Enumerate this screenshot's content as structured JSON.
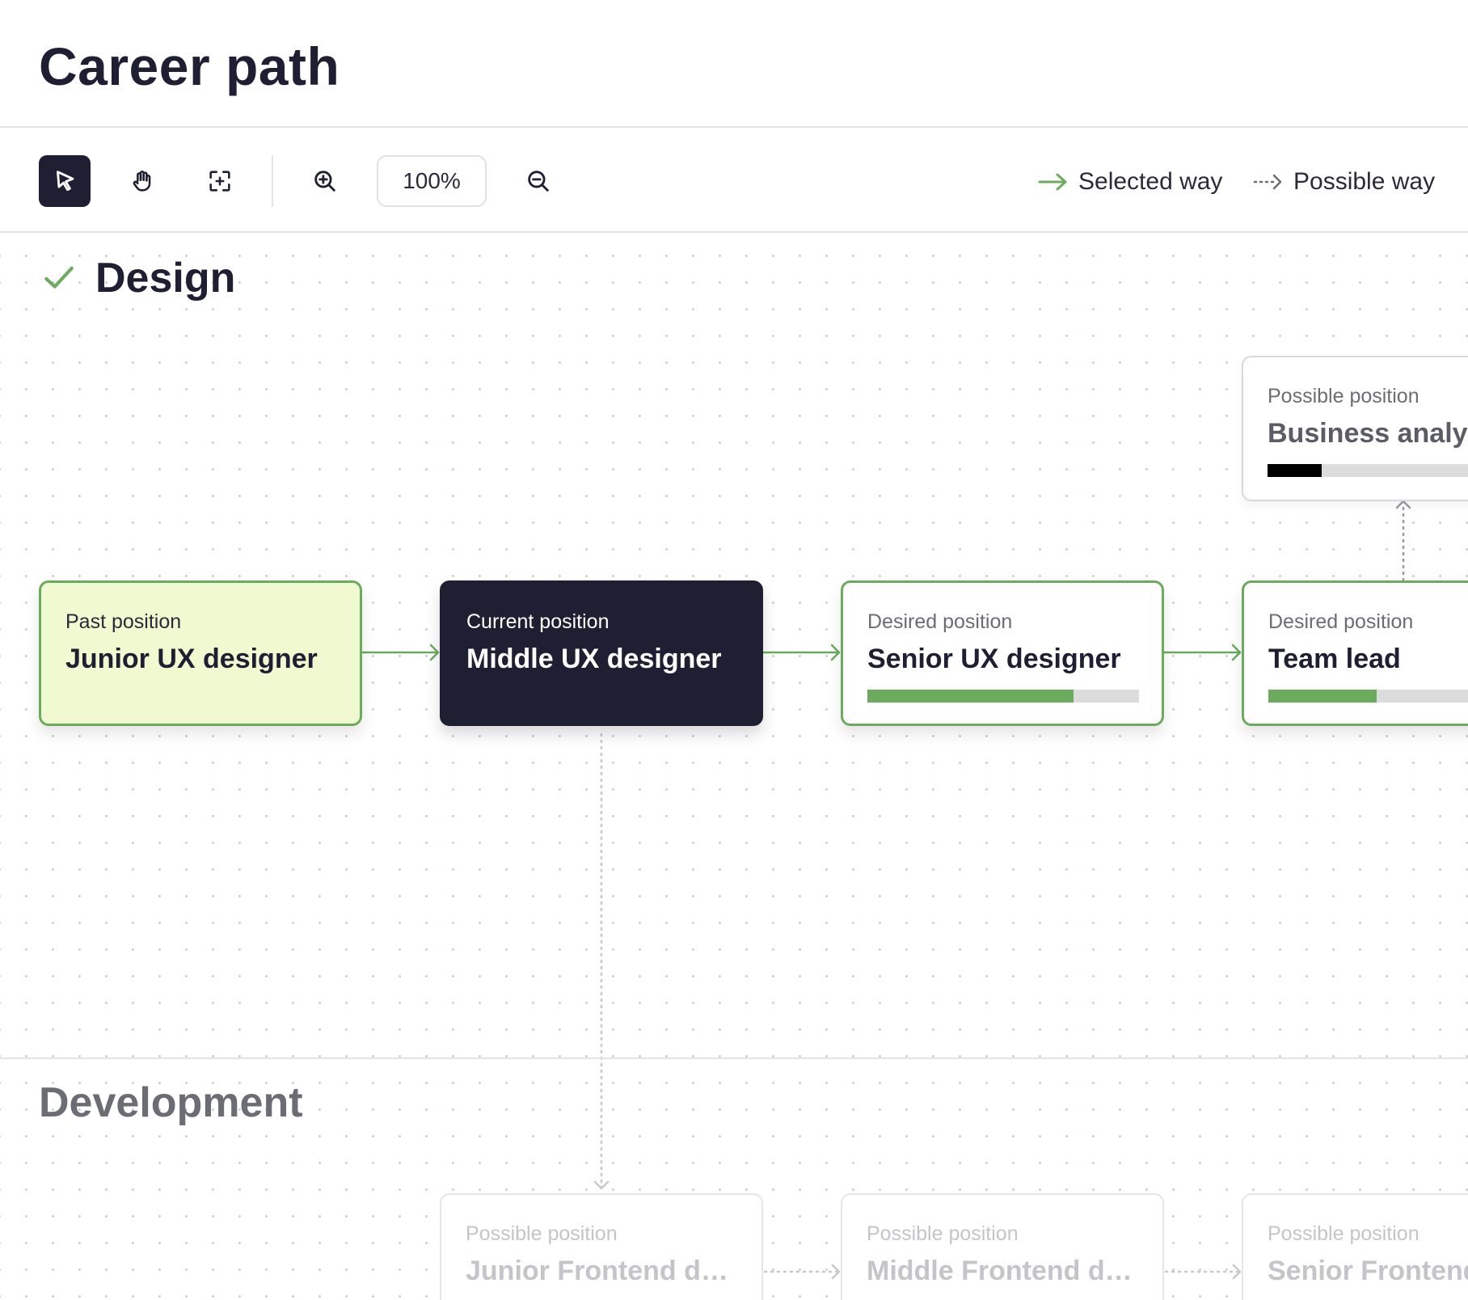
{
  "page": {
    "title": "Career path"
  },
  "toolbar": {
    "tools": [
      {
        "name": "select-tool",
        "icon": "cursor-icon",
        "active": true
      },
      {
        "name": "pan-tool",
        "icon": "hand-icon",
        "active": false
      },
      {
        "name": "fit-tool",
        "icon": "fit-screen-icon",
        "active": false
      }
    ],
    "zoom_in_icon": "zoom-in-icon",
    "zoom_level": "100%",
    "zoom_out_icon": "zoom-out-icon",
    "legend": {
      "selected_label": "Selected way",
      "possible_label": "Possible way"
    }
  },
  "sections": {
    "design": {
      "title": "Design",
      "icon": "check-icon"
    },
    "development": {
      "title": "Development"
    }
  },
  "cards": {
    "past": {
      "subtitle": "Past position",
      "title": "Junior UX designer"
    },
    "current": {
      "subtitle": "Current position",
      "title": "Middle UX designer"
    },
    "senior": {
      "subtitle": "Desired position",
      "title": "Senior UX designer",
      "progress": 0.76
    },
    "teamlead": {
      "subtitle": "Desired position",
      "title": "Team lead",
      "progress": 0.4
    },
    "business": {
      "subtitle": "Possible position",
      "title": "Business analyst",
      "progress": 0.2
    },
    "junior_fe": {
      "subtitle": "Possible position",
      "title": "Junior Frontend dev..."
    },
    "middle_fe": {
      "subtitle": "Possible position",
      "title": "Middle Frontend de..."
    },
    "senior_fe": {
      "subtitle": "Possible position",
      "title": "Senior Frontend"
    }
  },
  "colors": {
    "primary_dark": "#1f1f33",
    "accent_green": "#6aab5c",
    "past_bg": "#f1f9d0"
  }
}
